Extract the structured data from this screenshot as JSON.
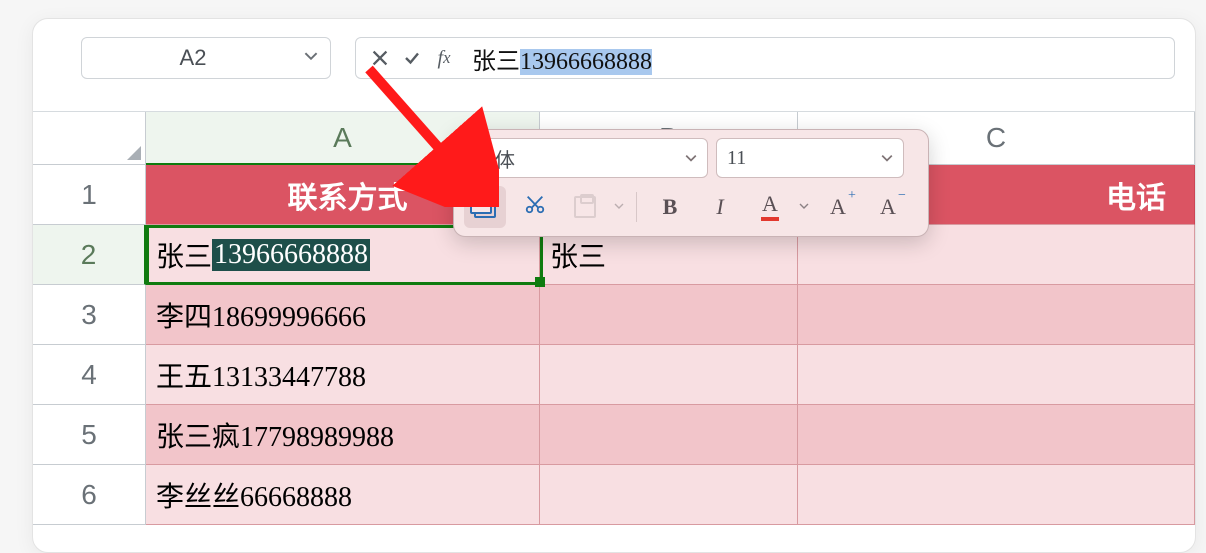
{
  "namebox": {
    "value": "A2"
  },
  "formula": {
    "prefix": "张三",
    "selected": "13966668888"
  },
  "columns": {
    "A": "A",
    "B": "B",
    "C": "C"
  },
  "rows": {
    "r1": "1",
    "r2": "2",
    "r3": "3",
    "r4": "4",
    "r5": "5",
    "r6": "6"
  },
  "header_row": {
    "A": "联系方式",
    "C_fragment": "电话"
  },
  "data": {
    "A2_name": "张三",
    "A2_num": "13966668888",
    "A3": "李四18699996666",
    "A4": "王五13133447788",
    "A5": "张三疯17798989988",
    "A6": "李丝丝66668888",
    "B2": "张三"
  },
  "mini": {
    "font": "宋体",
    "size": "11",
    "bold": "B",
    "italic": "I",
    "fontcolor_letter": "A",
    "grow": "A",
    "shrink": "A"
  }
}
